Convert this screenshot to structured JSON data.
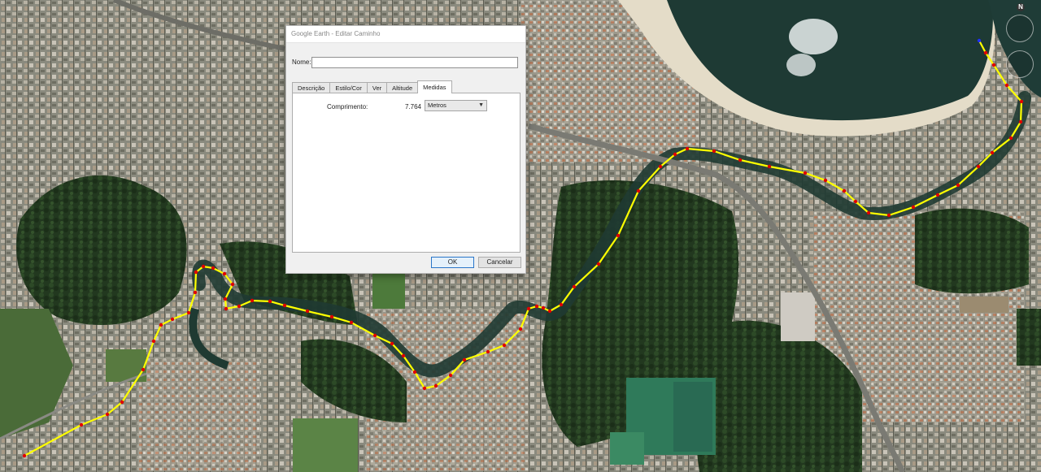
{
  "dialog": {
    "title": "Google Earth - Editar Caminho",
    "name_label": "Nome:",
    "name_value": "",
    "tabs": [
      {
        "label": "Descrição",
        "active": false
      },
      {
        "label": "Estilo/Cor",
        "active": false
      },
      {
        "label": "Ver",
        "active": false
      },
      {
        "label": "Altitude",
        "active": false
      },
      {
        "label": "Medidas",
        "active": true
      }
    ],
    "measure_label": "Comprimento:",
    "measure_value": "7.764",
    "unit_selected": "Metros",
    "ok_label": "OK",
    "cancel_label": "Cancelar"
  },
  "nav": {
    "north_label": "N"
  },
  "colors": {
    "path_line": "#ffff00",
    "path_point": "#e00000",
    "water": "#1e3a34",
    "beach": "#e4dcc8"
  }
}
